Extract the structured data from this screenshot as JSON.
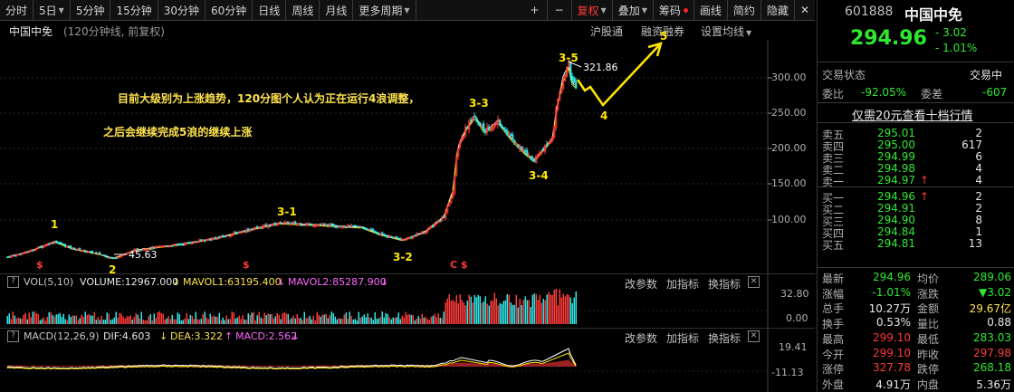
{
  "toolbar": {
    "left": [
      {
        "label": "分时"
      },
      {
        "label": "5日",
        "caret": true
      },
      {
        "label": "5分钟"
      },
      {
        "label": "15分钟"
      },
      {
        "label": "30分钟"
      },
      {
        "label": "60分钟"
      },
      {
        "label": "日线"
      },
      {
        "label": "周线"
      },
      {
        "label": "月线"
      },
      {
        "label": "更多周期",
        "caret": true
      }
    ],
    "right": [
      {
        "label": "+"
      },
      {
        "label": "−"
      },
      {
        "label": "复权",
        "caret": true,
        "active": true
      },
      {
        "label": "叠加",
        "caret": true
      },
      {
        "label": "筹码",
        "dot": true
      },
      {
        "label": "画线"
      },
      {
        "label": "简约"
      },
      {
        "label": "隐藏"
      },
      {
        "label": "✕"
      }
    ]
  },
  "chart": {
    "title": "中国中免",
    "subtitle": "(120分钟线, 前复权)",
    "links": [
      "沪股通",
      "融资融券",
      "设置均线"
    ],
    "annotation_line1": "目前大级别为上涨趋势，120分图个人认为正在运行4浪调整，",
    "annotation_line2": "之后会继续完成5浪的继续上涨",
    "max_label": "321.86",
    "min_label": "45.63",
    "wave_labels": [
      "1",
      "2",
      "3-1",
      "3-2",
      "3-3",
      "3-4",
      "3-5",
      "4",
      "5"
    ],
    "markers": [
      "$",
      "$",
      "C $"
    ],
    "price_axis": [
      "300.00",
      "250.00",
      "200.00",
      "150.00",
      "100.00"
    ],
    "colors": {
      "up": "#ff3a3a",
      "down": "#2ee8e8",
      "wave": "#ffe600",
      "ma": "#ffffff"
    }
  },
  "vol_panel": {
    "title": "VOL(5,10)",
    "volume": "VOLUME:12967.000",
    "mavol1": "MAVOL1:63195.400",
    "mavol2": "MAVOL2:85287.900",
    "axis": [
      "32.80",
      "0.00"
    ],
    "actions": [
      "改参数",
      "加指标",
      "换指标"
    ]
  },
  "macd_panel": {
    "title": "MACD(12,26,9)",
    "dif": "DIF:4.603",
    "dea": "DEA:3.322",
    "macd": "MACD:2.562",
    "axis": [
      "19.41",
      "-11.13"
    ],
    "actions": [
      "改参数",
      "加指标",
      "换指标"
    ]
  },
  "quote": {
    "code": "601888",
    "name": "中国中免",
    "price": "294.96",
    "change": "- 3.02",
    "change_pct": "- 1.01%",
    "status_label": "交易状态",
    "status_value": "交易中",
    "ratio_label": "委比",
    "ratio_value": "-92.05%",
    "diff_label": "委差",
    "diff_value": "-607",
    "level2_link": "仅需20元查看十档行情",
    "asks": [
      {
        "label": "卖五",
        "price": "295.01",
        "vol": "2"
      },
      {
        "label": "卖四",
        "price": "295.00",
        "vol": "617"
      },
      {
        "label": "卖三",
        "price": "294.99",
        "vol": "6"
      },
      {
        "label": "卖二",
        "price": "294.98",
        "vol": "4"
      },
      {
        "label": "卖一",
        "price": "294.97",
        "vol": "4"
      }
    ],
    "bids": [
      {
        "label": "买一",
        "price": "294.96",
        "vol": "2"
      },
      {
        "label": "买二",
        "price": "294.91",
        "vol": "2"
      },
      {
        "label": "买三",
        "price": "294.90",
        "vol": "8"
      },
      {
        "label": "买四",
        "price": "294.84",
        "vol": "1"
      },
      {
        "label": "买五",
        "price": "294.81",
        "vol": "13"
      }
    ],
    "stats": [
      [
        "最新",
        "294.96",
        "均价",
        "289.06"
      ],
      [
        "涨幅",
        "-1.01%",
        "涨跌",
        "▼3.02"
      ],
      [
        "总手",
        "10.27万",
        "金额",
        "29.67亿"
      ],
      [
        "换手",
        "0.53%",
        "量比",
        "0.88"
      ],
      [
        "最高",
        "299.10",
        "最低",
        "283.03"
      ],
      [
        "今开",
        "299.10",
        "昨收",
        "297.98"
      ],
      [
        "涨停",
        "327.78",
        "跌停",
        "268.18"
      ],
      [
        "外盘",
        "4.91万",
        "内盘",
        "5.36万"
      ]
    ]
  }
}
